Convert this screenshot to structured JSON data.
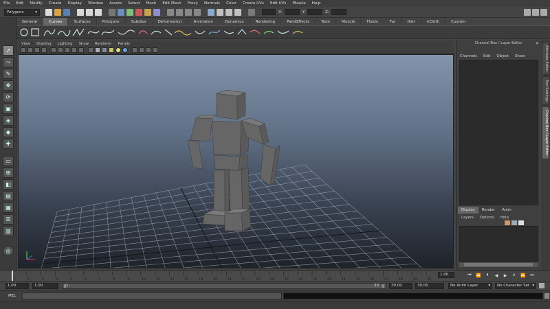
{
  "menubar": [
    "File",
    "Edit",
    "Modify",
    "Create",
    "Display",
    "Window",
    "Assets",
    "Select",
    "Mesh",
    "Edit Mesh",
    "Proxy",
    "Normals",
    "Color",
    "Create UVs",
    "Edit UVs",
    "Muscle",
    "Help"
  ],
  "status": {
    "mode": "Polygons",
    "x_label": "X:",
    "y_label": "Y:",
    "z_label": "Z:"
  },
  "shelf_tabs": [
    {
      "label": "General",
      "active": false
    },
    {
      "label": "Curves",
      "active": true
    },
    {
      "label": "Surfaces",
      "active": false
    },
    {
      "label": "Polygons",
      "active": false
    },
    {
      "label": "Subdivs",
      "active": false
    },
    {
      "label": "Deformation",
      "active": false
    },
    {
      "label": "Animation",
      "active": false
    },
    {
      "label": "Dynamics",
      "active": false
    },
    {
      "label": "Rendering",
      "active": false
    },
    {
      "label": "PaintEffects",
      "active": false
    },
    {
      "label": "Toon",
      "active": false
    },
    {
      "label": "Muscle",
      "active": false
    },
    {
      "label": "Fluids",
      "active": false
    },
    {
      "label": "Fur",
      "active": false
    },
    {
      "label": "Hair",
      "active": false
    },
    {
      "label": "nCloth",
      "active": false
    },
    {
      "label": "Custom",
      "active": false
    }
  ],
  "viewport_menu": [
    "View",
    "Shading",
    "Lighting",
    "Show",
    "Renderer",
    "Panels"
  ],
  "right_panel": {
    "title": "Channel Box / Layer Editor",
    "menu": [
      "Channels",
      "Edit",
      "Object",
      "Show"
    ],
    "tabs": [
      {
        "label": "Display",
        "active": true
      },
      {
        "label": "Render",
        "active": false
      },
      {
        "label": "Anim",
        "active": false
      }
    ],
    "layer_menu": [
      "Layers",
      "Options",
      "Help"
    ]
  },
  "side_tabs": [
    {
      "label": "Attribute Editor",
      "active": false
    },
    {
      "label": "Tool Settings",
      "active": false
    },
    {
      "label": "Channel Box / Layer Editor",
      "active": true
    }
  ],
  "timeline": {
    "ticks": [
      "1",
      "2",
      "3",
      "4",
      "5",
      "6",
      "7",
      "8",
      "9",
      "10",
      "11",
      "12",
      "13",
      "14",
      "15",
      "16",
      "17",
      "18",
      "19",
      "20",
      "21",
      "22",
      "23",
      "24",
      "25",
      "26",
      "27",
      "28",
      "29",
      "30"
    ],
    "current": "1.00"
  },
  "range": {
    "start": "1.00",
    "inner_start": "1.00",
    "slider_start": "1",
    "slider_end": "30",
    "end": "30.00",
    "outer_end": "30.00",
    "anim_layer": "No Anim Layer",
    "char_set": "No Character Set"
  },
  "cmd": {
    "label": "MEL"
  },
  "colors": {
    "active_tab": "#666666",
    "grid": "#9aa4b0",
    "robot": "#666666"
  }
}
